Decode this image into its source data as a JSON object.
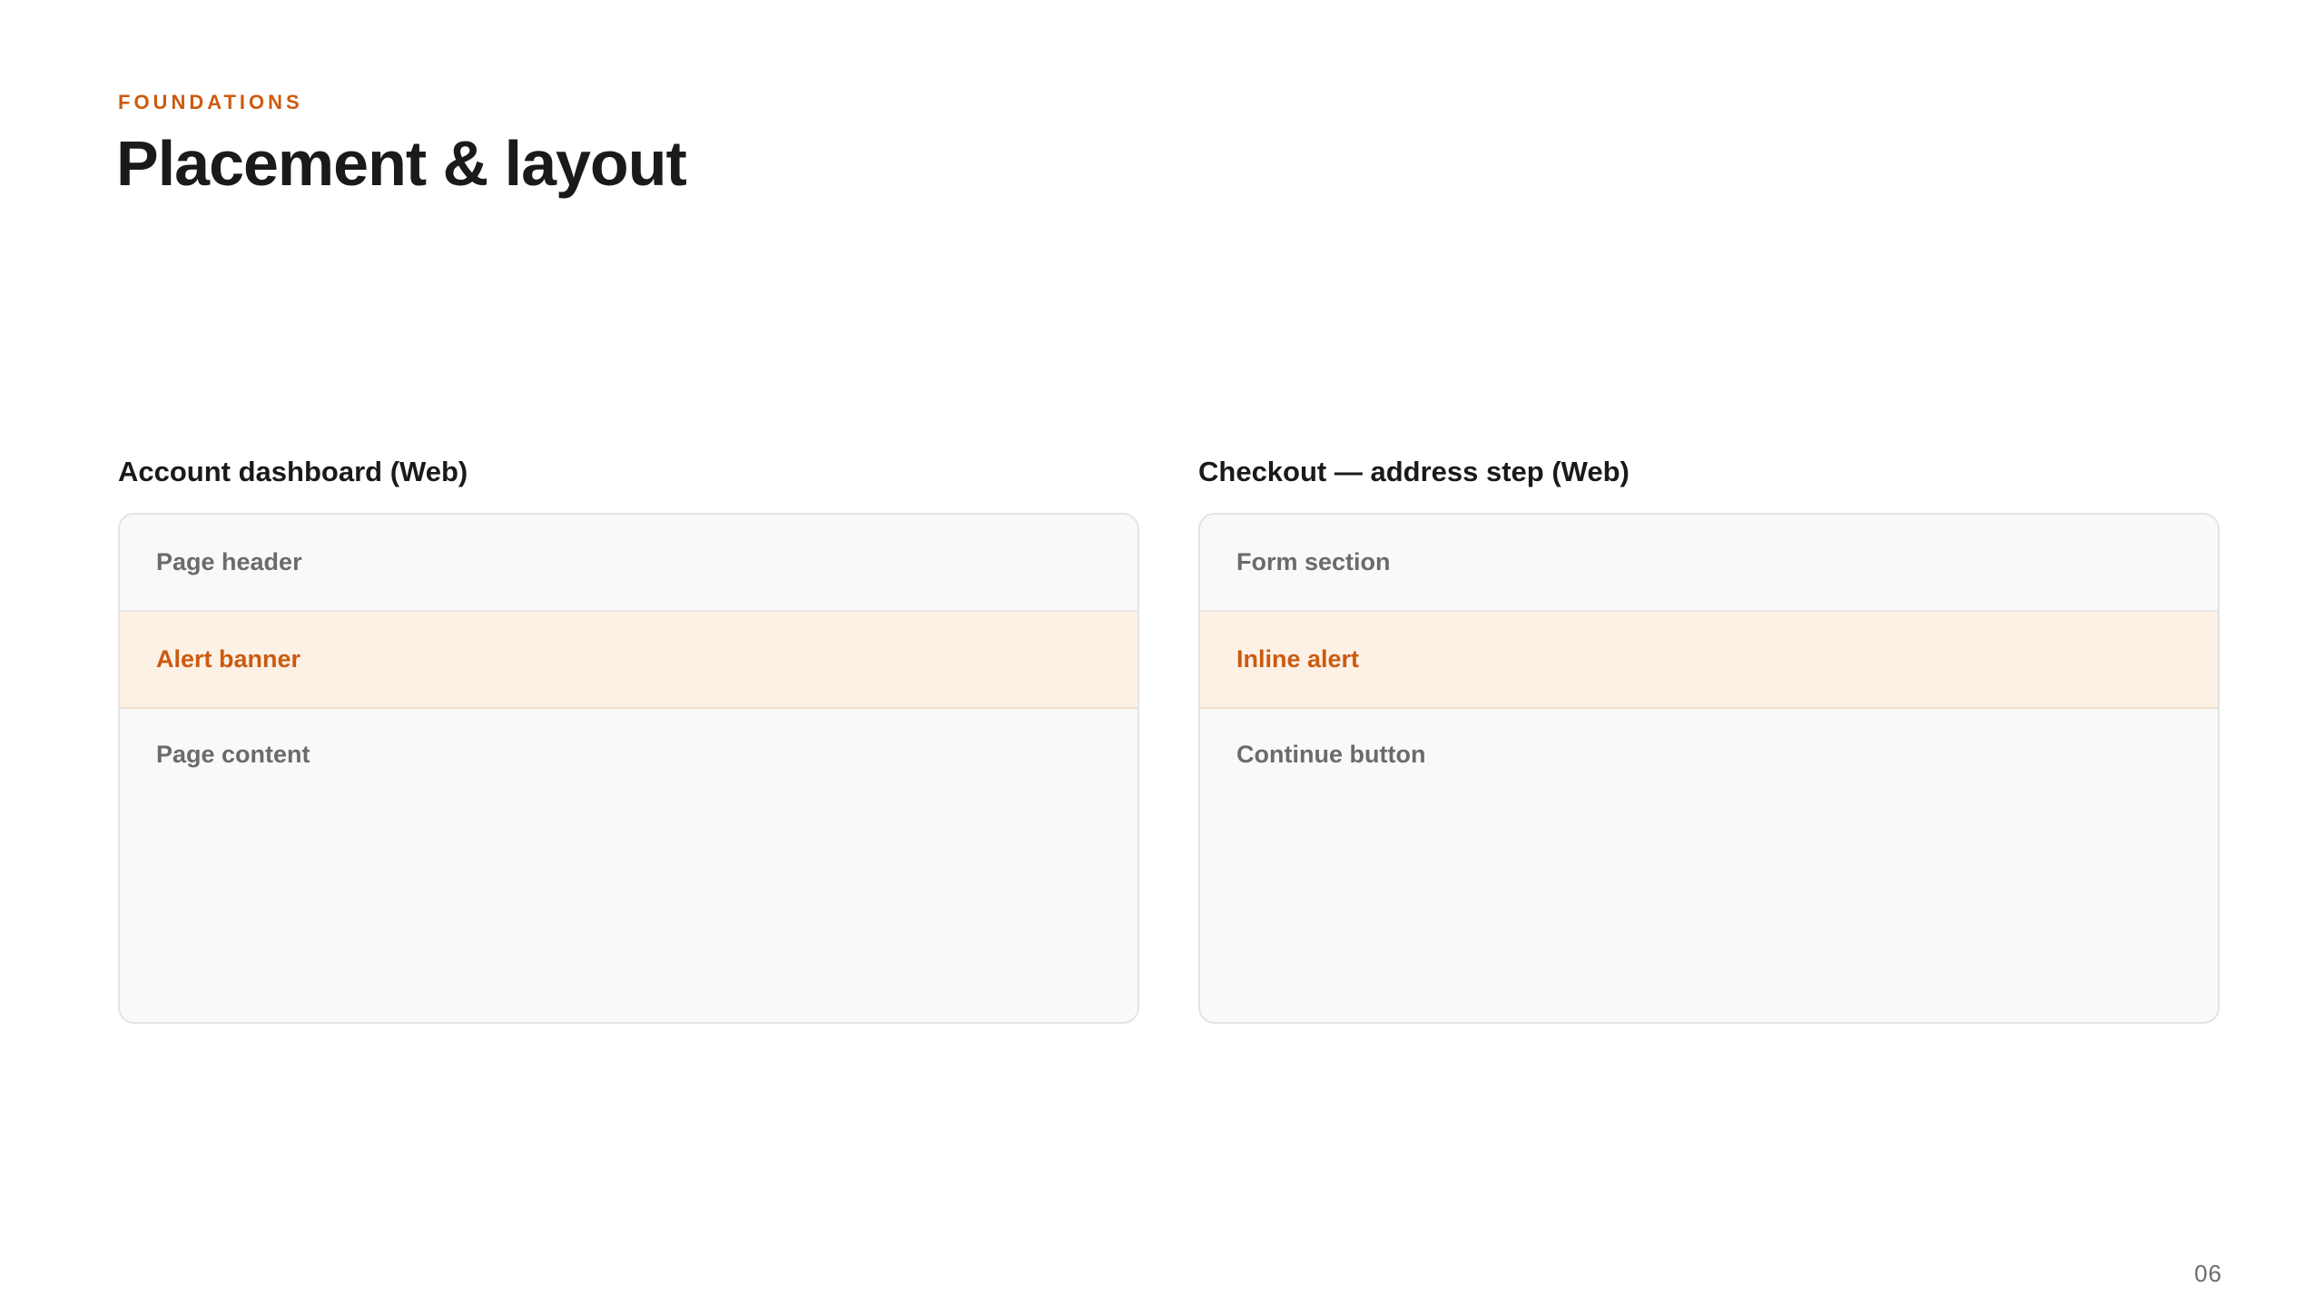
{
  "header": {
    "eyebrow": "FOUNDATIONS",
    "title": "Placement & layout"
  },
  "panels": [
    {
      "label": "Account dashboard (Web)",
      "rows": [
        "Page header",
        "Alert banner",
        "Page content"
      ],
      "highlight_index": 1
    },
    {
      "label": "Checkout — address step (Web)",
      "rows": [
        "Form section",
        "Inline alert",
        "Continue button"
      ],
      "highlight_index": 1
    }
  ],
  "footer": {
    "page_number": "06"
  },
  "colors": {
    "accent": "#cc5a0f",
    "highlight_bg": "#fdf1e6",
    "frame_bg": "#f9f9f9",
    "frame_border": "#e3e3e3",
    "muted_text": "#6b6b6b",
    "heading_text": "#1a1a1a"
  }
}
